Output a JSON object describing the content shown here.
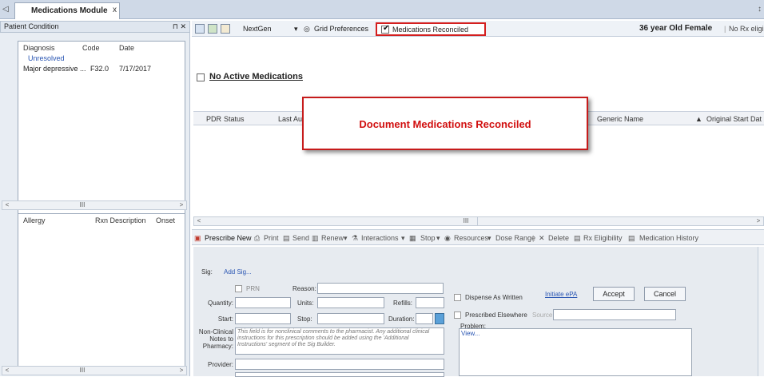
{
  "tab": {
    "title": "Medications Module",
    "close": "x",
    "nav_arrow": "◁"
  },
  "right_edge_glyph": "↕",
  "left_panel": {
    "header": "Patient Condition",
    "header_controls": "⊓ ✕",
    "diagnosis": {
      "columns": [
        "Diagnosis",
        "Code",
        "Date"
      ],
      "group": "Unresolved",
      "rows": [
        {
          "diagnosis": "Major depressive ...",
          "code": "F32.0",
          "date": "7/17/2017"
        }
      ]
    },
    "allergy": {
      "columns": [
        "Allergy",
        "Rxn Description",
        "Onset"
      ]
    },
    "scroll": {
      "left": "<",
      "thumb": "III",
      "right": ">"
    }
  },
  "toolbar": {
    "source": "NextGen",
    "grid_preferences": "Grid Preferences",
    "meds_reconciled_label": "Medications Reconciled",
    "meds_reconciled_checked": true,
    "patient_info": "36 year Old Female",
    "rx_eligibility": "No Rx eligibility status"
  },
  "no_active": "No Active Medications",
  "grid_columns": [
    "PDR",
    "Status",
    "Last Au",
    "Generic Name",
    "Original Start Dat"
  ],
  "callout": "Document Medications Reconciled",
  "mid_scroll": {
    "left": "<",
    "thumb": "III",
    "right": ">"
  },
  "action_bar": {
    "prescribe_new": "Prescribe New",
    "print": "Print",
    "send": "Send",
    "renew": "Renew",
    "interactions": "Interactions",
    "stop": "Stop",
    "resources": "Resources",
    "dose_range": "Dose Range",
    "delete": "Delete",
    "rx_eligibility": "Rx Eligibility",
    "medication_history": "Medication History"
  },
  "form": {
    "sig_label": "Sig:",
    "add_sig": "Add Sig...",
    "prn": "PRN",
    "reason": "Reason:",
    "quantity": "Quantity:",
    "units": "Units:",
    "refills": "Refills:",
    "start": "Start:",
    "stop": "Stop:",
    "duration": "Duration:",
    "notes_label": "Non-Clinical Notes to Pharmacy:",
    "notes_placeholder": "This field is for nonclinical comments to the pharmacist. Any additional clinical instructions for this prescription should be added using the 'Additional Instructions' segment of the Sig Builder.",
    "provider": "Provider:",
    "dispense_as_written": "Dispense As Written",
    "prescribed_elsewhere": "Prescribed Elsewhere",
    "source": "Source:",
    "initiate_epa": "Initiate ePA",
    "accept": "Accept",
    "cancel": "Cancel",
    "problem": "Problem:",
    "view": "View..."
  }
}
